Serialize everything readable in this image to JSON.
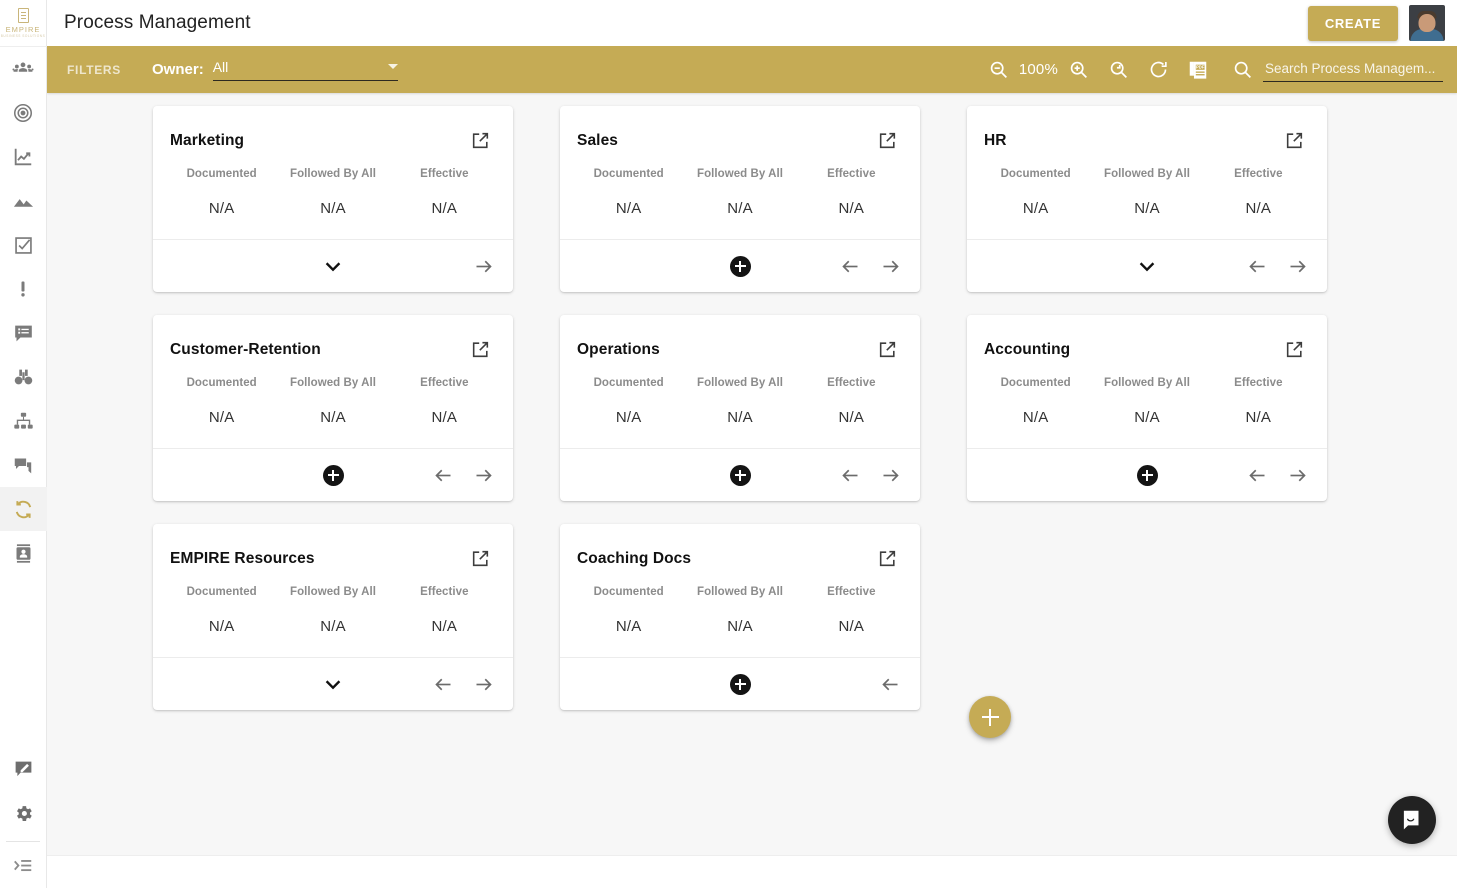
{
  "header": {
    "title": "Process Management",
    "create_label": "CREATE",
    "avatar_name": "user-avatar"
  },
  "sidebar": {
    "logo": {
      "name": "EMPIRE",
      "subtitle": "BUSINESS SOLUTIONS"
    },
    "items": [
      {
        "icon": "people-icon",
        "active": false
      },
      {
        "icon": "target-icon",
        "active": false
      },
      {
        "icon": "line-chart-icon",
        "active": false
      },
      {
        "icon": "mountains-icon",
        "active": false
      },
      {
        "icon": "checkbox-icon",
        "active": false
      },
      {
        "icon": "exclamation-icon",
        "active": false
      },
      {
        "icon": "comment-list-icon",
        "active": false
      },
      {
        "icon": "binoculars-icon",
        "active": false
      },
      {
        "icon": "org-chart-icon",
        "active": false
      },
      {
        "icon": "chat-bubbles-icon",
        "active": false
      },
      {
        "icon": "process-cycle-icon",
        "active": true
      },
      {
        "icon": "contact-card-icon",
        "active": false
      }
    ],
    "footer_items": [
      {
        "icon": "feedback-pencil-icon"
      },
      {
        "icon": "gear-icon"
      },
      {
        "icon": "collapse-menu-icon"
      }
    ]
  },
  "filterbar": {
    "filters_label": "FILTERS",
    "owner_label": "Owner:",
    "owner_value": "All",
    "owner_options": [
      "All"
    ],
    "zoom_level": "100%",
    "tools": [
      {
        "name": "zoom-out-icon"
      },
      {
        "name": "zoom-in-icon"
      },
      {
        "name": "zoom-reset-icon"
      },
      {
        "name": "refresh-icon"
      },
      {
        "name": "export-pdf-icon"
      }
    ],
    "search_placeholder": "Search Process Managem...",
    "search_value": "",
    "accent_color": "#c5ab55"
  },
  "main": {
    "metric_labels": [
      "Documented",
      "Followed By All",
      "Effective"
    ],
    "cards": [
      {
        "title": "Marketing",
        "values": [
          "N/A",
          "N/A",
          "N/A"
        ],
        "center_action": "chevron-down",
        "has_prev": false,
        "has_next": true
      },
      {
        "title": "Sales",
        "values": [
          "N/A",
          "N/A",
          "N/A"
        ],
        "center_action": "plus",
        "has_prev": true,
        "has_next": true
      },
      {
        "title": "HR",
        "values": [
          "N/A",
          "N/A",
          "N/A"
        ],
        "center_action": "chevron-down",
        "has_prev": true,
        "has_next": true
      },
      {
        "title": "Customer-Retention",
        "values": [
          "N/A",
          "N/A",
          "N/A"
        ],
        "center_action": "plus",
        "has_prev": true,
        "has_next": true
      },
      {
        "title": "Operations",
        "values": [
          "N/A",
          "N/A",
          "N/A"
        ],
        "center_action": "plus",
        "has_prev": true,
        "has_next": true
      },
      {
        "title": "Accounting",
        "values": [
          "N/A",
          "N/A",
          "N/A"
        ],
        "center_action": "plus",
        "has_prev": true,
        "has_next": true
      },
      {
        "title": "EMPIRE Resources",
        "values": [
          "N/A",
          "N/A",
          "N/A"
        ],
        "center_action": "chevron-down",
        "has_prev": true,
        "has_next": true
      },
      {
        "title": "Coaching Docs",
        "values": [
          "N/A",
          "N/A",
          "N/A"
        ],
        "center_action": "plus",
        "has_prev": true,
        "has_next": false
      }
    ]
  },
  "fab": {
    "name": "add-process-fab"
  },
  "chat": {
    "name": "intercom-chat-launcher"
  }
}
